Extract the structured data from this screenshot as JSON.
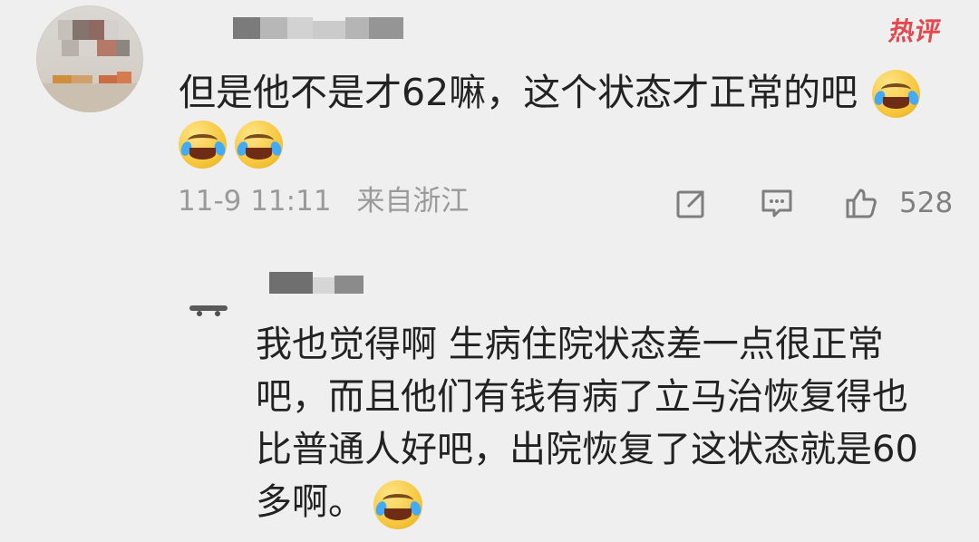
{
  "badge": {
    "hot_label": "热评"
  },
  "main_comment": {
    "text": "但是他不是才62嘛，这个状态才正常的吧",
    "meta": {
      "date_time": "11-9 11:11",
      "location": "来自浙江"
    },
    "actions": {
      "like_count": "528",
      "share_icon": "share-icon",
      "comment_icon": "comment-icon",
      "like_icon": "thumbs-up-icon"
    },
    "emoji": "laughing-crying-emoji"
  },
  "reply": {
    "lines": [
      "我也觉得啊  生病住院状态差一点很正常",
      "吧，而且他们有钱有病了立马治恢复得也",
      "比普通人好吧，出院恢复了这状态就是60",
      "多啊。"
    ],
    "emoji": "laughing-crying-emoji"
  }
}
